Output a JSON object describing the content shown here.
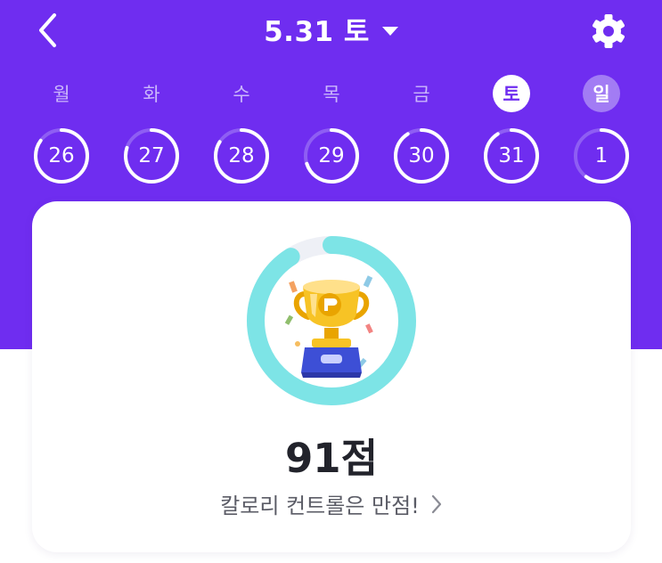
{
  "header": {
    "date_label": "5.31 토",
    "back_icon": "chevron-left-icon",
    "dropdown_icon": "caret-down-icon",
    "settings_icon": "gear-icon"
  },
  "week": [
    {
      "weekday": "월",
      "date": "26",
      "progress": 0.85,
      "state": "normal"
    },
    {
      "weekday": "화",
      "date": "27",
      "progress": 0.8,
      "state": "normal"
    },
    {
      "weekday": "수",
      "date": "28",
      "progress": 0.84,
      "state": "normal"
    },
    {
      "weekday": "목",
      "date": "29",
      "progress": 0.7,
      "state": "normal"
    },
    {
      "weekday": "금",
      "date": "30",
      "progress": 0.91,
      "state": "normal"
    },
    {
      "weekday": "토",
      "date": "31",
      "progress": 0.91,
      "state": "selected"
    },
    {
      "weekday": "일",
      "date": "1",
      "progress": 0.6,
      "state": "today"
    }
  ],
  "summary": {
    "score_value": 91,
    "score_label": "91점",
    "caption": "칼로리 컨트롤은 만점!",
    "trophy_icon": "trophy-icon",
    "chevron_icon": "chevron-right-icon"
  },
  "colors": {
    "brand_purple": "#6f2df0",
    "score_ring": "#7de4e6",
    "score_ring_track": "#eef0f6",
    "day_ring": "#ffffff",
    "day_ring_track": "#8e5ef3"
  }
}
